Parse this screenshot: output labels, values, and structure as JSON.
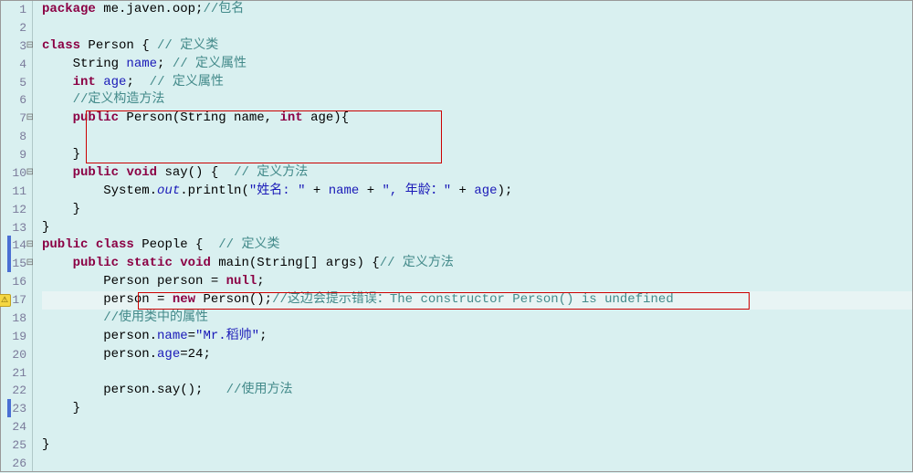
{
  "lines": [
    {
      "num": "1",
      "tokens": [
        {
          "text": "package",
          "cls": "kw"
        },
        {
          "text": " me.javen.oop;",
          "cls": "normal"
        },
        {
          "text": "//包名",
          "cls": "comment"
        }
      ]
    },
    {
      "num": "2",
      "tokens": []
    },
    {
      "num": "3",
      "fold": "⊟",
      "tokens": [
        {
          "text": "class",
          "cls": "kw"
        },
        {
          "text": " Person { ",
          "cls": "normal"
        },
        {
          "text": "// 定义类",
          "cls": "comment"
        }
      ]
    },
    {
      "num": "4",
      "tokens": [
        {
          "text": "    String ",
          "cls": "normal"
        },
        {
          "text": "name",
          "cls": "field"
        },
        {
          "text": "; ",
          "cls": "normal"
        },
        {
          "text": "// 定义属性",
          "cls": "comment"
        }
      ]
    },
    {
      "num": "5",
      "tokens": [
        {
          "text": "    ",
          "cls": "normal"
        },
        {
          "text": "int",
          "cls": "kw"
        },
        {
          "text": " ",
          "cls": "normal"
        },
        {
          "text": "age",
          "cls": "field"
        },
        {
          "text": ";  ",
          "cls": "normal"
        },
        {
          "text": "// 定义属性",
          "cls": "comment"
        }
      ]
    },
    {
      "num": "6",
      "tokens": [
        {
          "text": "    ",
          "cls": "normal"
        },
        {
          "text": "//定义构造方法",
          "cls": "comment"
        }
      ]
    },
    {
      "num": "7",
      "fold": "⊟",
      "tokens": [
        {
          "text": "    ",
          "cls": "normal"
        },
        {
          "text": "public",
          "cls": "kw"
        },
        {
          "text": " Person(String name, ",
          "cls": "normal"
        },
        {
          "text": "int",
          "cls": "kw"
        },
        {
          "text": " age){",
          "cls": "normal"
        }
      ]
    },
    {
      "num": "8",
      "tokens": []
    },
    {
      "num": "9",
      "tokens": [
        {
          "text": "    }",
          "cls": "normal"
        }
      ]
    },
    {
      "num": "10",
      "fold": "⊟",
      "tokens": [
        {
          "text": "    ",
          "cls": "normal"
        },
        {
          "text": "public",
          "cls": "kw"
        },
        {
          "text": " ",
          "cls": "normal"
        },
        {
          "text": "void",
          "cls": "kw"
        },
        {
          "text": " say() {  ",
          "cls": "normal"
        },
        {
          "text": "// 定义方法",
          "cls": "comment"
        }
      ]
    },
    {
      "num": "11",
      "tokens": [
        {
          "text": "        System.",
          "cls": "normal"
        },
        {
          "text": "out",
          "cls": "method-italic"
        },
        {
          "text": ".println(",
          "cls": "normal"
        },
        {
          "text": "\"姓名: \"",
          "cls": "string"
        },
        {
          "text": " + ",
          "cls": "normal"
        },
        {
          "text": "name",
          "cls": "field"
        },
        {
          "text": " + ",
          "cls": "normal"
        },
        {
          "text": "\", 年龄：\"",
          "cls": "string"
        },
        {
          "text": " + ",
          "cls": "normal"
        },
        {
          "text": "age",
          "cls": "field"
        },
        {
          "text": ");",
          "cls": "normal"
        }
      ]
    },
    {
      "num": "12",
      "tokens": [
        {
          "text": "    }",
          "cls": "normal"
        }
      ]
    },
    {
      "num": "13",
      "tokens": [
        {
          "text": "}",
          "cls": "normal"
        }
      ]
    },
    {
      "num": "14",
      "fold": "⊟",
      "blue": true,
      "tokens": [
        {
          "text": "public",
          "cls": "kw"
        },
        {
          "text": " ",
          "cls": "normal"
        },
        {
          "text": "class",
          "cls": "kw"
        },
        {
          "text": " People {  ",
          "cls": "normal"
        },
        {
          "text": "// 定义类",
          "cls": "comment"
        }
      ]
    },
    {
      "num": "15",
      "fold": "⊟",
      "blue": true,
      "tokens": [
        {
          "text": "    ",
          "cls": "normal"
        },
        {
          "text": "public",
          "cls": "kw"
        },
        {
          "text": " ",
          "cls": "normal"
        },
        {
          "text": "static",
          "cls": "kw"
        },
        {
          "text": " ",
          "cls": "normal"
        },
        {
          "text": "void",
          "cls": "kw"
        },
        {
          "text": " main(String[] args) {",
          "cls": "normal"
        },
        {
          "text": "// 定义方法",
          "cls": "comment"
        }
      ]
    },
    {
      "num": "16",
      "tokens": [
        {
          "text": "        Person person = ",
          "cls": "normal"
        },
        {
          "text": "null",
          "cls": "kw"
        },
        {
          "text": ";",
          "cls": "normal"
        }
      ]
    },
    {
      "num": "17",
      "marker": "⚠",
      "highlight": true,
      "tokens": [
        {
          "text": "        person = ",
          "cls": "normal"
        },
        {
          "text": "new",
          "cls": "kw"
        },
        {
          "text": " Person();",
          "cls": "normal"
        },
        {
          "text": "//这边会提示错误：The constructor Person() is undefined",
          "cls": "comment"
        }
      ]
    },
    {
      "num": "18",
      "tokens": [
        {
          "text": "        ",
          "cls": "normal"
        },
        {
          "text": "//使用类中的属性",
          "cls": "comment"
        }
      ]
    },
    {
      "num": "19",
      "tokens": [
        {
          "text": "        person.",
          "cls": "normal"
        },
        {
          "text": "name",
          "cls": "field"
        },
        {
          "text": "=",
          "cls": "normal"
        },
        {
          "text": "\"Mr.稻帅\"",
          "cls": "string"
        },
        {
          "text": ";",
          "cls": "normal"
        }
      ]
    },
    {
      "num": "20",
      "tokens": [
        {
          "text": "        person.",
          "cls": "normal"
        },
        {
          "text": "age",
          "cls": "field"
        },
        {
          "text": "=24;",
          "cls": "normal"
        }
      ]
    },
    {
      "num": "21",
      "tokens": []
    },
    {
      "num": "22",
      "tokens": [
        {
          "text": "        person.say();   ",
          "cls": "normal"
        },
        {
          "text": "//使用方法",
          "cls": "comment"
        }
      ]
    },
    {
      "num": "23",
      "blue": true,
      "tokens": [
        {
          "text": "    }",
          "cls": "normal"
        }
      ]
    },
    {
      "num": "24",
      "tokens": []
    },
    {
      "num": "25",
      "tokens": [
        {
          "text": "}",
          "cls": "normal"
        }
      ]
    },
    {
      "num": "26",
      "tokens": []
    }
  ]
}
